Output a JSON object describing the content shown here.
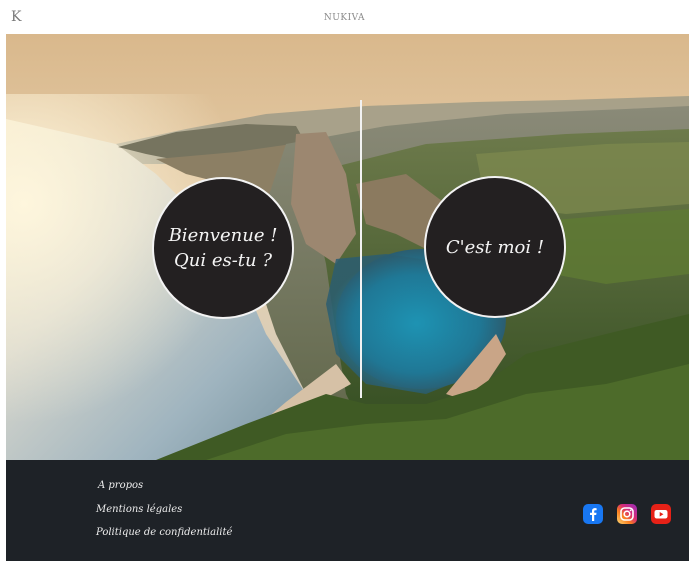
{
  "header": {
    "logo": "K",
    "site_title": "NUKIVA"
  },
  "hero": {
    "left_circle_text": "Bienvenue !\nQui es-tu ?",
    "right_circle_text": "C'est moi !"
  },
  "footer": {
    "links": [
      {
        "label": "A propos"
      },
      {
        "label": "Mentions légales"
      },
      {
        "label": "Politique de confidentialité"
      }
    ],
    "social": [
      {
        "icon": "facebook-icon",
        "color": "#1877f2"
      },
      {
        "icon": "instagram-icon",
        "color": "#d62976"
      },
      {
        "icon": "youtube-icon",
        "color": "#e62117"
      }
    ]
  }
}
